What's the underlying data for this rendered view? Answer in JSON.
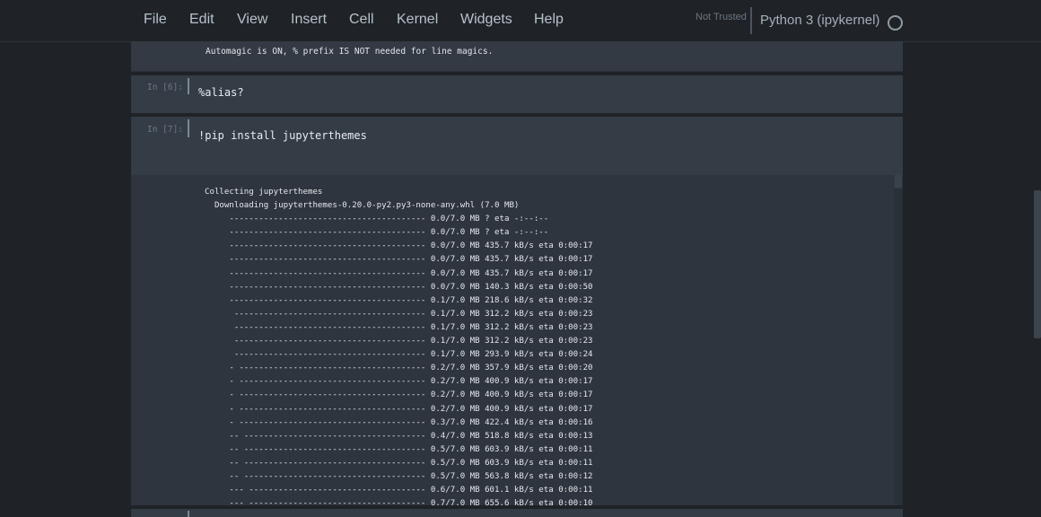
{
  "menu": {
    "items": [
      "File",
      "Edit",
      "View",
      "Insert",
      "Cell",
      "Kernel",
      "Widgets",
      "Help"
    ]
  },
  "status": {
    "trust": "Not Trusted",
    "kernel": "Python 3 (ipykernel)"
  },
  "cells": {
    "prev_output": "Automagic is ON, % prefix IS NOT needed for line magics.",
    "cell6": {
      "prompt": "In [6]:",
      "code": "%alias?"
    },
    "cell7": {
      "prompt": "In [7]:",
      "code": "!pip install jupyterthemes"
    }
  },
  "output": {
    "lines": [
      "Collecting jupyterthemes",
      "  Downloading jupyterthemes-0.20.0-py2.py3-none-any.whl (7.0 MB)",
      "     ---------------------------------------- 0.0/7.0 MB ? eta -:--:--",
      "     ---------------------------------------- 0.0/7.0 MB ? eta -:--:--",
      "     ---------------------------------------- 0.0/7.0 MB 435.7 kB/s eta 0:00:17",
      "     ---------------------------------------- 0.0/7.0 MB 435.7 kB/s eta 0:00:17",
      "     ---------------------------------------- 0.0/7.0 MB 435.7 kB/s eta 0:00:17",
      "     ---------------------------------------- 0.0/7.0 MB 140.3 kB/s eta 0:00:50",
      "     ---------------------------------------- 0.1/7.0 MB 218.6 kB/s eta 0:00:32",
      "      --------------------------------------- 0.1/7.0 MB 312.2 kB/s eta 0:00:23",
      "      --------------------------------------- 0.1/7.0 MB 312.2 kB/s eta 0:00:23",
      "      --------------------------------------- 0.1/7.0 MB 312.2 kB/s eta 0:00:23",
      "      --------------------------------------- 0.1/7.0 MB 293.9 kB/s eta 0:00:24",
      "     - -------------------------------------- 0.2/7.0 MB 357.9 kB/s eta 0:00:20",
      "     - -------------------------------------- 0.2/7.0 MB 400.9 kB/s eta 0:00:17",
      "     - -------------------------------------- 0.2/7.0 MB 400.9 kB/s eta 0:00:17",
      "     - -------------------------------------- 0.2/7.0 MB 400.9 kB/s eta 0:00:17",
      "     - -------------------------------------- 0.3/7.0 MB 422.4 kB/s eta 0:00:16",
      "     -- ------------------------------------- 0.4/7.0 MB 518.8 kB/s eta 0:00:13",
      "     -- ------------------------------------- 0.5/7.0 MB 603.9 kB/s eta 0:00:11",
      "     -- ------------------------------------- 0.5/7.0 MB 603.9 kB/s eta 0:00:11",
      "     -- ------------------------------------- 0.5/7.0 MB 563.8 kB/s eta 0:00:12",
      "     --- ------------------------------------ 0.6/7.0 MB 601.1 kB/s eta 0:00:11",
      "     --- ------------------------------------ 0.7/7.0 MB 655.6 kB/s eta 0:00:10"
    ]
  }
}
